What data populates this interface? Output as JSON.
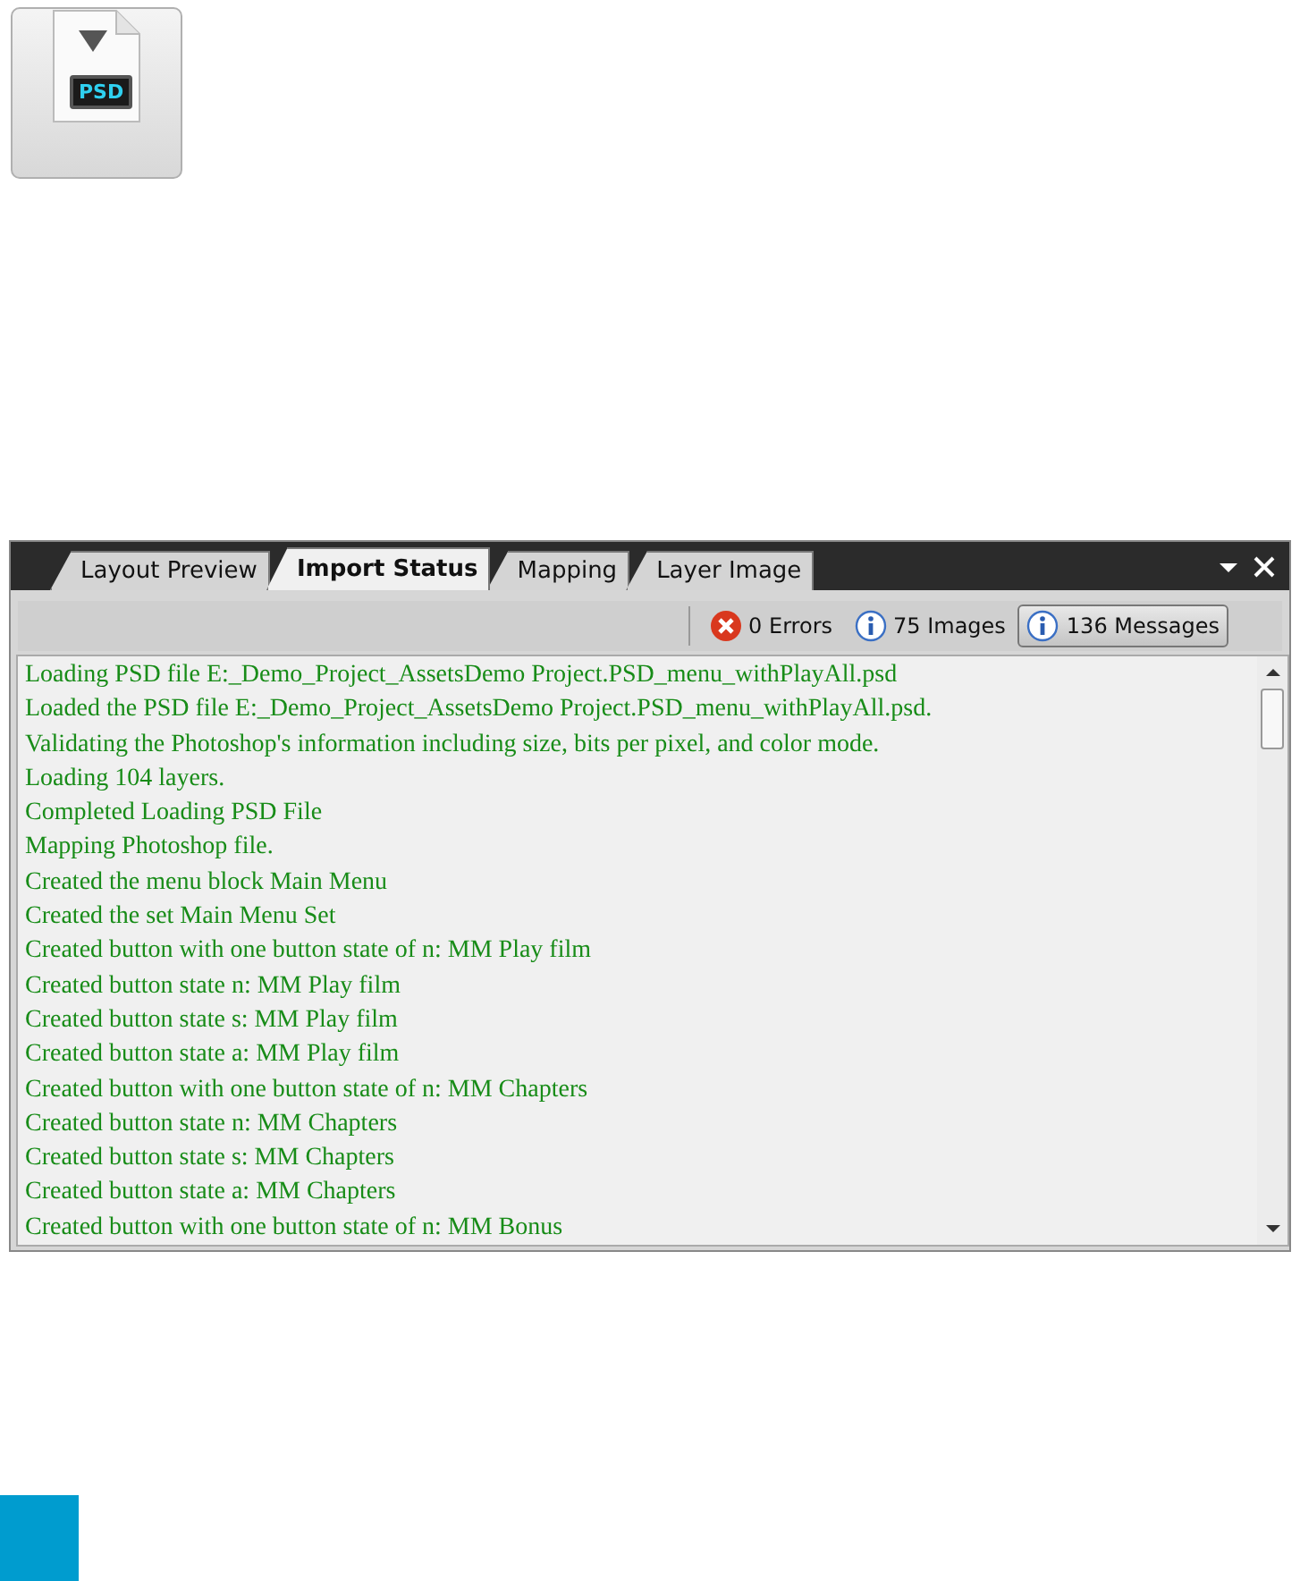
{
  "import_button": {
    "label": "PSD"
  },
  "tabs": [
    {
      "label": "Layout Preview",
      "selected": false
    },
    {
      "label": "Import Status",
      "selected": true
    },
    {
      "label": "Mapping",
      "selected": false
    },
    {
      "label": "Layer Image",
      "selected": false
    }
  ],
  "filters": [
    {
      "kind": "error",
      "label": "0 Errors",
      "selected": false
    },
    {
      "kind": "info",
      "label": "75 Images",
      "selected": false
    },
    {
      "kind": "info",
      "label": "136 Messages",
      "selected": true
    }
  ],
  "log": [
    "Loading PSD file E:_Demo_Project_AssetsDemo Project.PSD_menu_withPlayAll.psd",
    "Loaded the PSD file E:_Demo_Project_AssetsDemo Project.PSD_menu_withPlayAll.psd.",
    "Validating the Photoshop's information including size, bits per pixel, and color mode.",
    "Loading 104 layers.",
    "Completed Loading PSD File",
    "Mapping Photoshop file.",
    "Created the menu block Main Menu",
    "Created the set Main Menu Set",
    "Created button with one button state of n: MM Play film",
    "Created button state n: MM Play film",
    "Created button state s: MM Play film",
    "Created button state a: MM Play film",
    "Created button with one button state of n: MM Chapters",
    "Created button state n: MM Chapters",
    "Created button state s: MM Chapters",
    "Created button state a: MM Chapters",
    "Created button with one button state of n: MM Bonus"
  ]
}
